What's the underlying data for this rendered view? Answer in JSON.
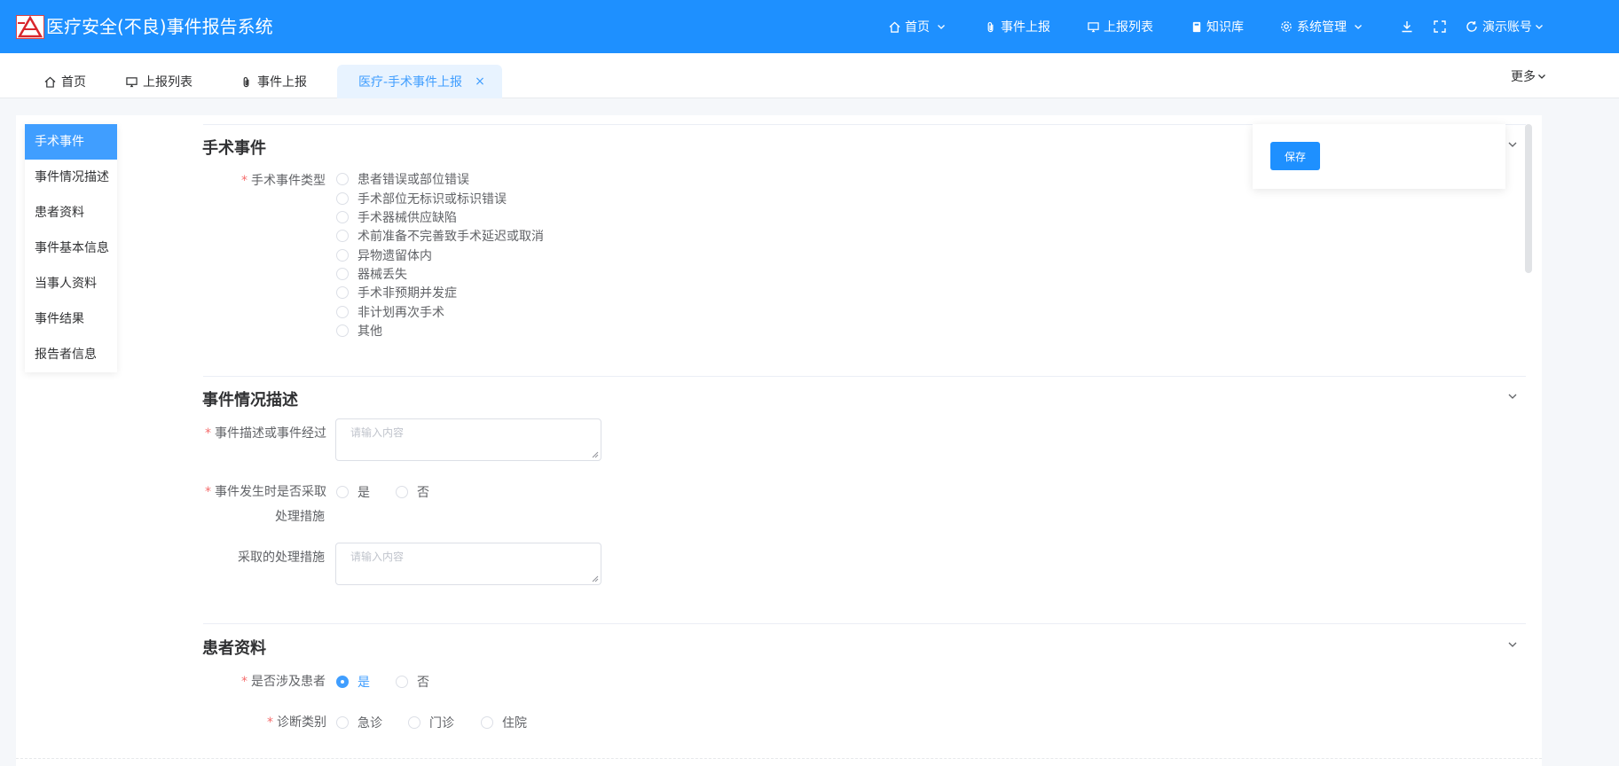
{
  "header": {
    "app_title": "医疗安全(不良)事件报告系统",
    "nav": [
      {
        "label": "首页",
        "icon": "home-icon"
      },
      {
        "label": "事件上报",
        "icon": "paperclip-icon"
      },
      {
        "label": "上报列表",
        "icon": "monitor-icon"
      },
      {
        "label": "知识库",
        "icon": "book-icon"
      },
      {
        "label": "系统管理",
        "icon": "gear-icon"
      }
    ],
    "account": "演示账号"
  },
  "tabs": {
    "items": [
      {
        "label": "首页",
        "icon": "home-icon"
      },
      {
        "label": "上报列表",
        "icon": "monitor-icon"
      },
      {
        "label": "事件上报",
        "icon": "paperclip-icon"
      }
    ],
    "active_label": "医疗-手术事件上报",
    "close": "×",
    "more": "更多"
  },
  "sidebar": {
    "items": [
      {
        "label": "手术事件",
        "active": true
      },
      {
        "label": "事件情况描述",
        "active": false
      },
      {
        "label": "患者资料",
        "active": false
      },
      {
        "label": "事件基本信息",
        "active": false
      },
      {
        "label": "当事人资料",
        "active": false
      },
      {
        "label": "事件结果",
        "active": false
      },
      {
        "label": "报告者信息",
        "active": false
      }
    ]
  },
  "save_label": "保存",
  "sections": {
    "surgery": {
      "title": "手术事件",
      "type_label": "手术事件类型",
      "options": [
        "患者错误或部位错误",
        "手术部位无标识或标识错误",
        "手术器械供应缺陷",
        "术前准备不完善致手术延迟或取消",
        "异物遗留体内",
        "器械丢失",
        "手术非预期并发症",
        "非计划再次手术",
        "其他"
      ]
    },
    "description": {
      "title": "事件情况描述",
      "desc_label": "事件描述或事件经过",
      "desc_placeholder": "请输入内容",
      "measures_q_line1": "事件发生时是否采取",
      "measures_q_line2": "处理措施",
      "yes": "是",
      "no": "否",
      "measures_label": "采取的处理措施",
      "measures_placeholder": "请输入内容"
    },
    "patient": {
      "title": "患者资料",
      "involved_label": "是否涉及患者",
      "yes": "是",
      "no": "否",
      "selected": "是",
      "diag_label": "诊断类别",
      "diag_options": [
        "急诊",
        "门诊",
        "住院"
      ]
    }
  },
  "required_mark": "*",
  "colors": {
    "primary": "#1e90ff",
    "accent": "#409eff",
    "required": "#f56c6c"
  }
}
